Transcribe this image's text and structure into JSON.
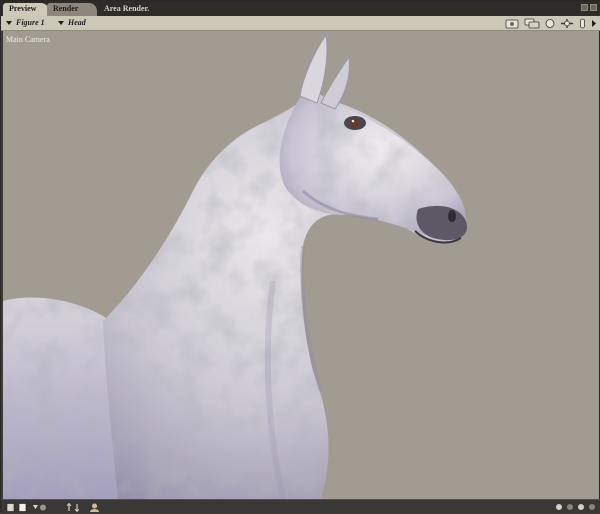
{
  "tabs": [
    {
      "label": "Preview",
      "active": true
    },
    {
      "label": "Render",
      "active": false
    },
    {
      "label": "Area Render.",
      "active": false
    }
  ],
  "menus": {
    "figure": "Figure 1",
    "element": "Head"
  },
  "toolbar_icons": [
    "camera-icon",
    "multi-camera-icon",
    "sphere-icon",
    "move-icon",
    "slider-icon",
    "arrow-right-icon"
  ],
  "viewport": {
    "camera_label": "Main Camera",
    "background_color": "#a29b92",
    "subject": "horse-figure"
  },
  "bottom_icons": [
    "new-document-icon",
    "dropdown-arrow-icon",
    "render-settings-icon",
    "sort-icon",
    "figure-icon"
  ],
  "colors": {
    "menubar": "#cdc7b7",
    "tab_active": "#cfc9b9",
    "viewport_bg": "#a29b92"
  }
}
